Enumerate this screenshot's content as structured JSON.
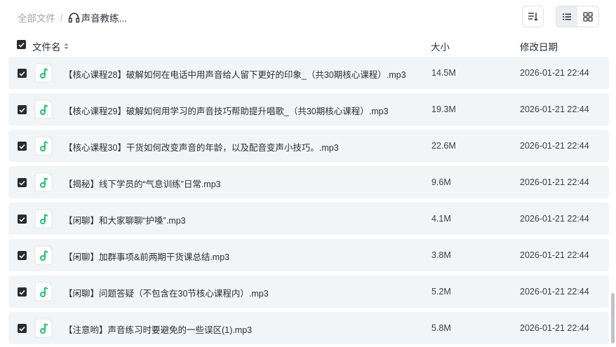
{
  "breadcrumb": {
    "root": "全部文件",
    "separator": "/",
    "current": "声音教练..."
  },
  "toolbar": {
    "sort_icon": "sort-list-icon",
    "list_view_icon": "list-view-icon",
    "grid_view_icon": "grid-view-icon",
    "active_view": "list"
  },
  "table": {
    "headers": {
      "name": "文件名",
      "size": "大小",
      "date": "修改日期"
    },
    "rows": [
      {
        "name": "【核心课程28】破解如何在电话中用声音给人留下更好的印象_（共30期核心课程）.mp3",
        "size": "14.5M",
        "date": "2026-01-21 22:44",
        "checked": true
      },
      {
        "name": "【核心课程29】破解如何用学习的声音技巧帮助提升唱歌_（共30期核心课程）.mp3",
        "size": "19.3M",
        "date": "2026-01-21 22:44",
        "checked": true
      },
      {
        "name": "【核心课程30】干货如何改变声音的年龄，以及配音变声小技巧。.mp3",
        "size": "22.6M",
        "date": "2026-01-21 22:44",
        "checked": true
      },
      {
        "name": "【揭秘】线下学员的“气息训练”日常.mp3",
        "size": "9.6M",
        "date": "2026-01-21 22:44",
        "checked": true
      },
      {
        "name": "【闲聊】和大家聊聊“护嗓”.mp3",
        "size": "4.1M",
        "date": "2026-01-21 22:44",
        "checked": true
      },
      {
        "name": "【闲聊】加群事项&前两期干货课总结.mp3",
        "size": "3.8M",
        "date": "2026-01-21 22:44",
        "checked": true
      },
      {
        "name": "【闲聊】问题答疑（不包含在30节核心课程内）.mp3",
        "size": "5.2M",
        "date": "2026-01-21 22:44",
        "checked": true
      },
      {
        "name": "【注意哟】声音练习时要避免的一些误区(1).mp3",
        "size": "5.8M",
        "date": "2026-01-21 22:44",
        "checked": true
      }
    ]
  },
  "colors": {
    "audio_icon": "#1fc36a",
    "row_bg": "#f3f4f6",
    "checkbox": "#2b2b2b"
  }
}
